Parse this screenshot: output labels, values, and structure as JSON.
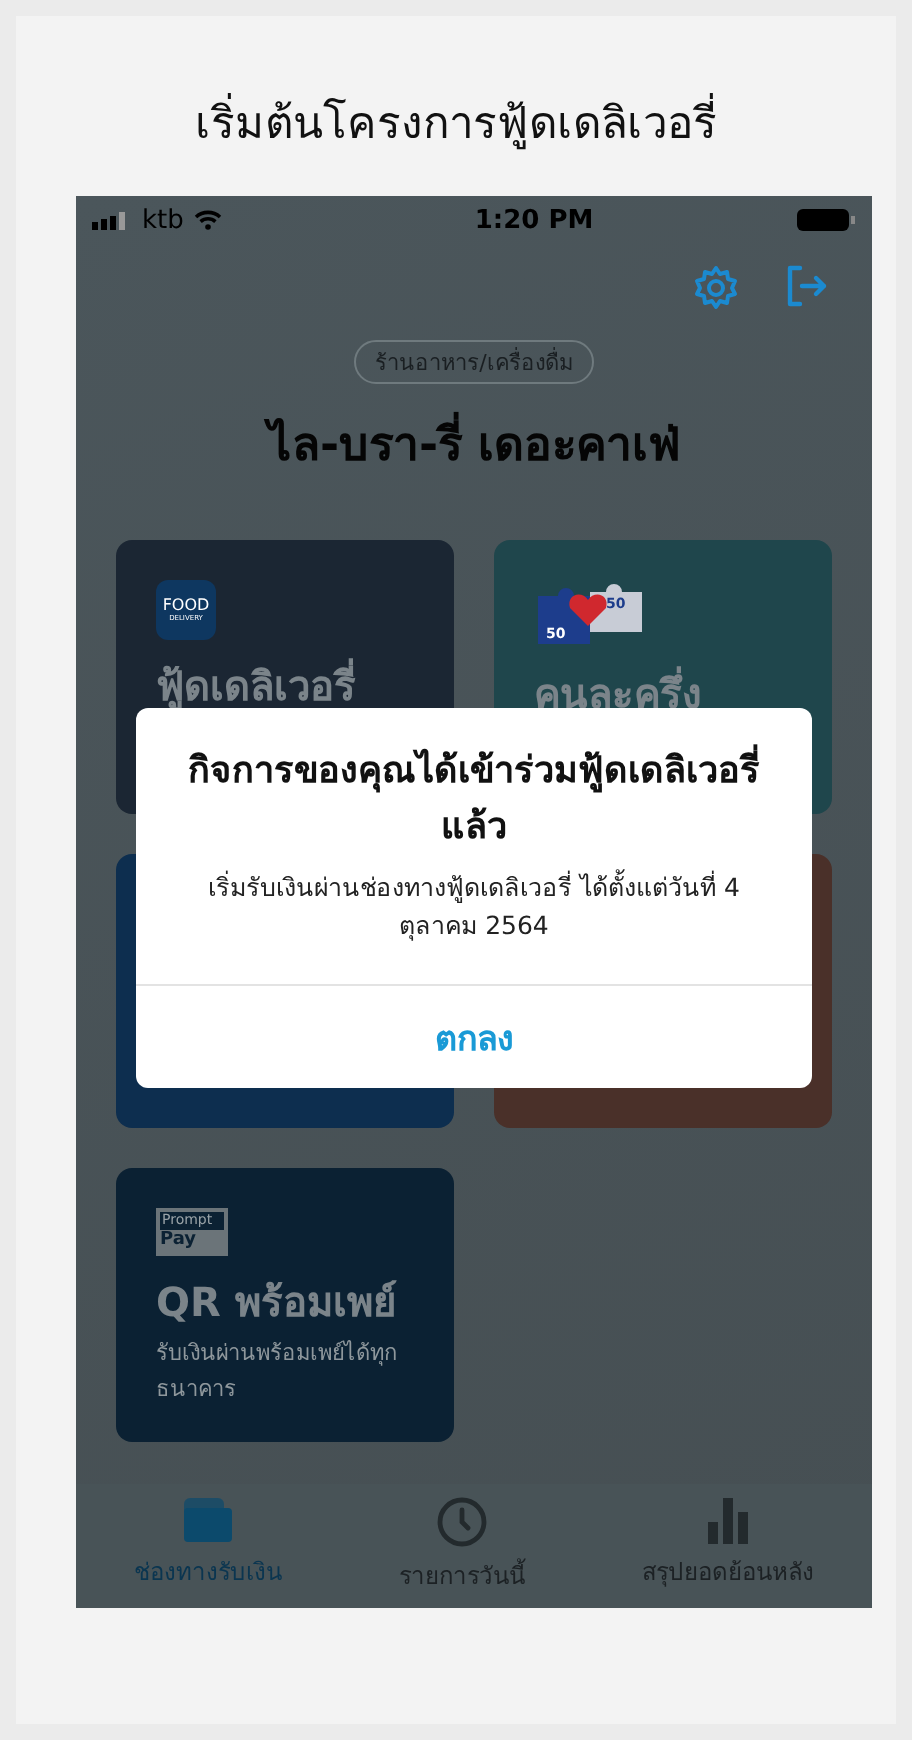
{
  "page_title": "เริ่มต้นโครงการฟู้ดเดลิเวอรี่",
  "status_bar": {
    "carrier": "ktb",
    "time": "1:20 PM"
  },
  "shop": {
    "category": "ร้านอาหาร/เครื่องดื่ม",
    "name": "ไล-บรา-รี่ เดอะคาเฟ่"
  },
  "cards": [
    {
      "kind": "food",
      "color": "#1b2633",
      "title": "ฟู้ดเดลิเวอรี่",
      "icon_text": [
        "FOOD",
        "DELIVERY"
      ]
    },
    {
      "kind": "half",
      "color": "#1f464c",
      "title": "คนละครึ่ง",
      "icon_text": [
        "50",
        "50"
      ]
    },
    {
      "kind": "plain",
      "color": "#0d2e4f"
    },
    {
      "kind": "plain",
      "color": "#4a3029"
    },
    {
      "kind": "promptpay",
      "color": "#0b2133",
      "title": "QR พร้อมเพย์",
      "description": "รับเงินผ่านพร้อมเพย์ได้ทุกธนาคาร",
      "icon_text": [
        "Prompt",
        "Pay"
      ]
    }
  ],
  "dialog": {
    "title": "กิจการของคุณได้เข้าร่วมฟู้ดเดลิเวอรี่แล้ว",
    "message": "เริ่มรับเงินผ่านช่องทางฟู้ดเดลิเวอรี่ ได้ตั้งแต่วันที่ 4 ตุลาคม 2564",
    "button": "ตกลง"
  },
  "tabs": [
    {
      "kind": "wallet",
      "label": "ช่องทางรับเงิน",
      "selected": true
    },
    {
      "kind": "clock",
      "label": "รายการวันนี้",
      "selected": false
    },
    {
      "kind": "chart",
      "label": "สรุปยอดย้อนหลัง",
      "selected": false
    }
  ]
}
